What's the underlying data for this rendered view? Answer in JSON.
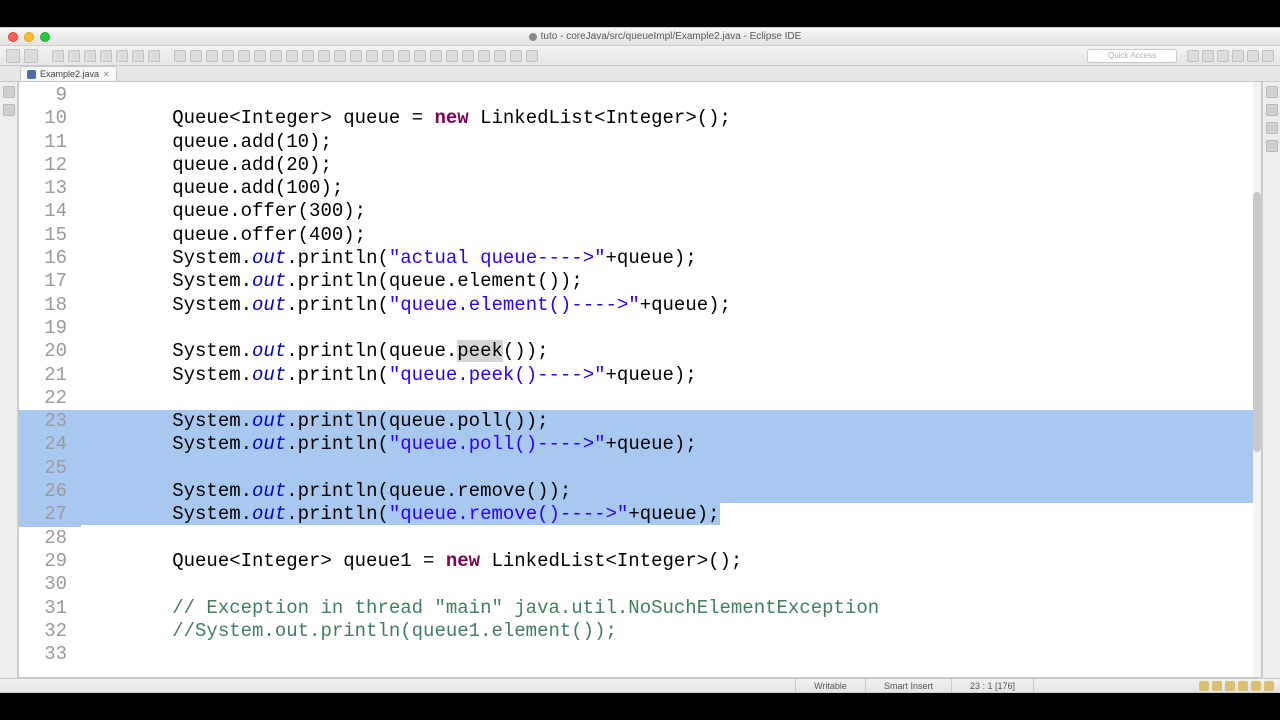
{
  "window": {
    "title": "tuto - coreJava/src/queueImpl/Example2.java - Eclipse IDE"
  },
  "tab": {
    "label": "Example2.java"
  },
  "quick_access": "Quick Access",
  "status": {
    "writable": "Writable",
    "insert": "Smart Insert",
    "pos": "23 : 1 [176]"
  },
  "code": {
    "lines": [
      {
        "n": 9,
        "sel": false,
        "tokens": [
          {
            "t": "",
            "c": ""
          }
        ]
      },
      {
        "n": 10,
        "sel": false,
        "tokens": [
          {
            "t": "        Queue<Integer> queue = ",
            "c": ""
          },
          {
            "t": "new",
            "c": "kw"
          },
          {
            "t": " LinkedList<Integer>();",
            "c": ""
          }
        ]
      },
      {
        "n": 11,
        "sel": false,
        "tokens": [
          {
            "t": "        queue.add(10);",
            "c": ""
          }
        ]
      },
      {
        "n": 12,
        "sel": false,
        "tokens": [
          {
            "t": "        queue.add(20);",
            "c": ""
          }
        ]
      },
      {
        "n": 13,
        "sel": false,
        "tokens": [
          {
            "t": "        queue.add(100);",
            "c": ""
          }
        ]
      },
      {
        "n": 14,
        "sel": false,
        "tokens": [
          {
            "t": "        queue.offer(300);",
            "c": ""
          }
        ]
      },
      {
        "n": 15,
        "sel": false,
        "tokens": [
          {
            "t": "        queue.offer(400);",
            "c": ""
          }
        ]
      },
      {
        "n": 16,
        "sel": false,
        "tokens": [
          {
            "t": "        System.",
            "c": ""
          },
          {
            "t": "out",
            "c": "fld"
          },
          {
            "t": ".println(",
            "c": ""
          },
          {
            "t": "\"actual queue---->\"",
            "c": "str"
          },
          {
            "t": "+queue);",
            "c": ""
          }
        ]
      },
      {
        "n": 17,
        "sel": false,
        "tokens": [
          {
            "t": "        System.",
            "c": ""
          },
          {
            "t": "out",
            "c": "fld"
          },
          {
            "t": ".println(queue.element());",
            "c": ""
          }
        ]
      },
      {
        "n": 18,
        "sel": false,
        "tokens": [
          {
            "t": "        System.",
            "c": ""
          },
          {
            "t": "out",
            "c": "fld"
          },
          {
            "t": ".println(",
            "c": ""
          },
          {
            "t": "\"queue.element()---->\"",
            "c": "str"
          },
          {
            "t": "+queue);",
            "c": ""
          }
        ]
      },
      {
        "n": 19,
        "sel": false,
        "tokens": [
          {
            "t": "",
            "c": ""
          }
        ]
      },
      {
        "n": 20,
        "sel": false,
        "tokens": [
          {
            "t": "        System.",
            "c": ""
          },
          {
            "t": "out",
            "c": "fld"
          },
          {
            "t": ".println(queue.",
            "c": ""
          },
          {
            "t": "peek",
            "c": "hl"
          },
          {
            "t": "());",
            "c": ""
          }
        ]
      },
      {
        "n": 21,
        "sel": false,
        "tokens": [
          {
            "t": "        System.",
            "c": ""
          },
          {
            "t": "out",
            "c": "fld"
          },
          {
            "t": ".println(",
            "c": ""
          },
          {
            "t": "\"queue.peek()---->\"",
            "c": "str"
          },
          {
            "t": "+queue);",
            "c": ""
          }
        ]
      },
      {
        "n": 22,
        "sel": false,
        "tokens": [
          {
            "t": "",
            "c": ""
          }
        ]
      },
      {
        "n": 23,
        "sel": true,
        "tokens": [
          {
            "t": "        System.",
            "c": ""
          },
          {
            "t": "out",
            "c": "fld"
          },
          {
            "t": ".println(queue.poll());",
            "c": ""
          }
        ]
      },
      {
        "n": 24,
        "sel": true,
        "tokens": [
          {
            "t": "        System.",
            "c": ""
          },
          {
            "t": "out",
            "c": "fld"
          },
          {
            "t": ".println(",
            "c": ""
          },
          {
            "t": "\"queue.poll()---->\"",
            "c": "str"
          },
          {
            "t": "+queue);",
            "c": ""
          }
        ]
      },
      {
        "n": 25,
        "sel": true,
        "tokens": [
          {
            "t": "",
            "c": ""
          }
        ]
      },
      {
        "n": 26,
        "sel": true,
        "tokens": [
          {
            "t": "        System.",
            "c": ""
          },
          {
            "t": "out",
            "c": "fld"
          },
          {
            "t": ".println(queue.remove());",
            "c": ""
          }
        ]
      },
      {
        "n": 27,
        "sel": "last",
        "tokens": [
          {
            "t": "        System.",
            "c": ""
          },
          {
            "t": "out",
            "c": "fld"
          },
          {
            "t": ".println(",
            "c": ""
          },
          {
            "t": "\"queue.remove()---->\"",
            "c": "str"
          },
          {
            "t": "+queue);",
            "c": ""
          }
        ]
      },
      {
        "n": 28,
        "sel": false,
        "tokens": [
          {
            "t": "",
            "c": ""
          }
        ]
      },
      {
        "n": 29,
        "sel": false,
        "tokens": [
          {
            "t": "        Queue<Integer> queue1 = ",
            "c": ""
          },
          {
            "t": "new",
            "c": "kw"
          },
          {
            "t": " LinkedList<Integer>();",
            "c": ""
          }
        ]
      },
      {
        "n": 30,
        "sel": false,
        "tokens": [
          {
            "t": "",
            "c": ""
          }
        ]
      },
      {
        "n": 31,
        "sel": false,
        "tokens": [
          {
            "t": "        ",
            "c": ""
          },
          {
            "t": "// Exception in thread \"main\" java.util.NoSuchElementException",
            "c": "cmt"
          }
        ]
      },
      {
        "n": 32,
        "sel": false,
        "tokens": [
          {
            "t": "        ",
            "c": ""
          },
          {
            "t": "//System.out.println(queue1.element());",
            "c": "cmt"
          }
        ]
      },
      {
        "n": 33,
        "sel": false,
        "tokens": [
          {
            "t": "",
            "c": ""
          }
        ]
      }
    ]
  }
}
